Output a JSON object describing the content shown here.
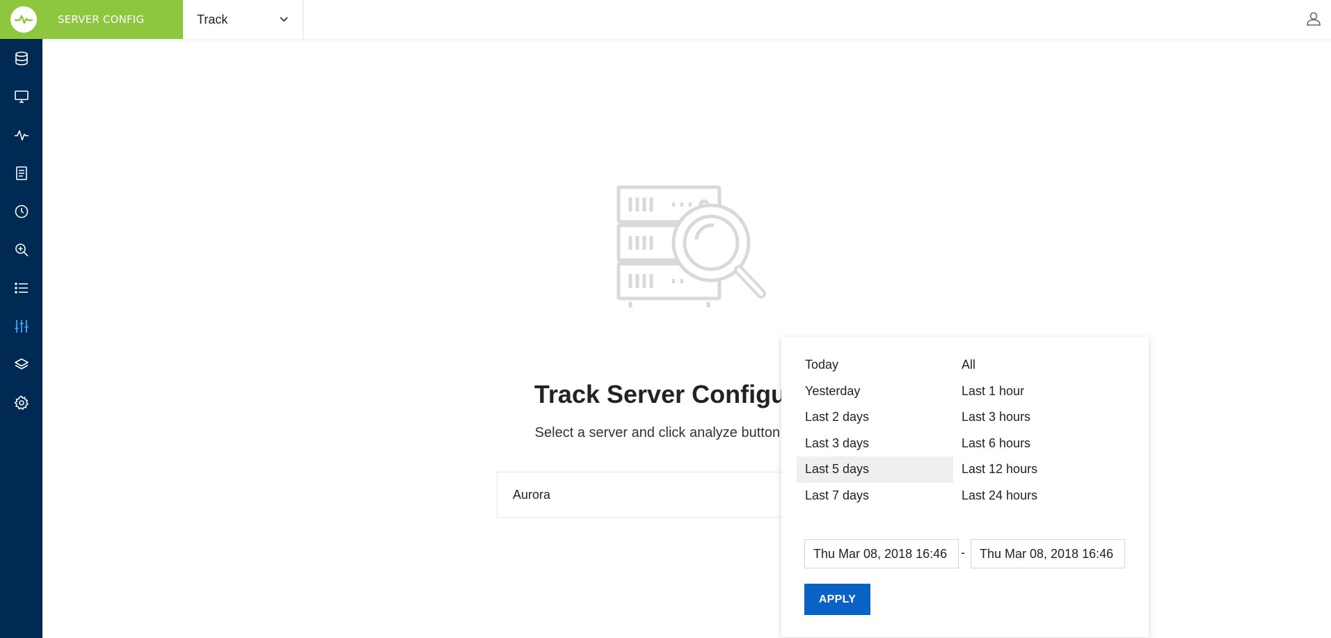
{
  "app": {
    "brand_title": "SERVER CONFIG",
    "brand_color": "#8dc63f",
    "sidebar_color": "#002a53",
    "accent_color": "#0a63c4"
  },
  "header": {
    "track_select_value": "Track"
  },
  "sidebar": {
    "items": [
      {
        "icon": "database-icon",
        "active": false
      },
      {
        "icon": "monitor-icon",
        "active": false
      },
      {
        "icon": "activity-icon",
        "active": false
      },
      {
        "icon": "document-icon",
        "active": false
      },
      {
        "icon": "clock-icon",
        "active": false
      },
      {
        "icon": "zoom-in-icon",
        "active": false
      },
      {
        "icon": "list-icon",
        "active": false
      },
      {
        "icon": "sliders-icon",
        "active": true
      },
      {
        "icon": "layers-icon",
        "active": false
      },
      {
        "icon": "gear-icon",
        "active": false
      }
    ]
  },
  "main": {
    "title": "Track Server Configur",
    "subtitle": "Select a server and click analyze button to",
    "server_select_value": "Aurora"
  },
  "range_panel": {
    "left_options": [
      "Today",
      "Yesterday",
      "Last 2 days",
      "Last 3 days",
      "Last 5 days",
      "Last 7 days"
    ],
    "right_options": [
      "All",
      "Last 1 hour",
      "Last 3 hours",
      "Last 6 hours",
      "Last 12 hours",
      "Last 24 hours"
    ],
    "highlighted_option": "Last 5 days",
    "start_date": "Thu Mar 08, 2018 16:46",
    "separator": "-",
    "end_date": "Thu Mar 08, 2018 16:46",
    "apply_label": "APPLY"
  }
}
